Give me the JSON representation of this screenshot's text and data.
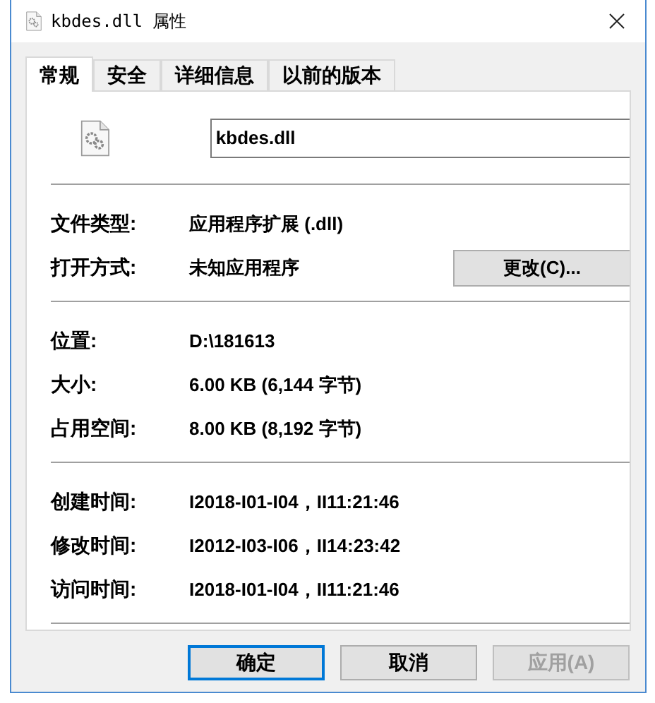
{
  "window": {
    "title": "kbdes.dll 属性"
  },
  "tabs": [
    {
      "label": "常规",
      "selected": true
    },
    {
      "label": "安全",
      "selected": false
    },
    {
      "label": "详细信息",
      "selected": false
    },
    {
      "label": "以前的版本",
      "selected": false
    }
  ],
  "file_name": {
    "value": "kbdes.dll"
  },
  "sections": [
    {
      "rows": [
        {
          "label": "文件类型:",
          "value": "应用程序扩展 (.dll)"
        },
        {
          "label": "打开方式:",
          "value": "未知应用程序",
          "button": "更改(C)..."
        }
      ]
    },
    {
      "rows": [
        {
          "label": "位置:",
          "value": "D:\\181613"
        },
        {
          "label": "大小:",
          "value": "6.00 KB (6,144 字节)"
        },
        {
          "label": "占用空间:",
          "value": "8.00 KB (8,192 字节)"
        }
      ]
    },
    {
      "rows": [
        {
          "label": "创建时间:",
          "value": "I2018-I01-I04，II11:21:46"
        },
        {
          "label": "修改时间:",
          "value": "I2012-I03-I06，II14:23:42"
        },
        {
          "label": "访问时间:",
          "value": "I2018-I01-I04，II11:21:46"
        }
      ]
    }
  ],
  "buttons": [
    {
      "label": "确定",
      "default": true,
      "disabled": false
    },
    {
      "label": "取消",
      "default": false,
      "disabled": false
    },
    {
      "label": "应用(A)",
      "default": false,
      "disabled": true
    }
  ]
}
